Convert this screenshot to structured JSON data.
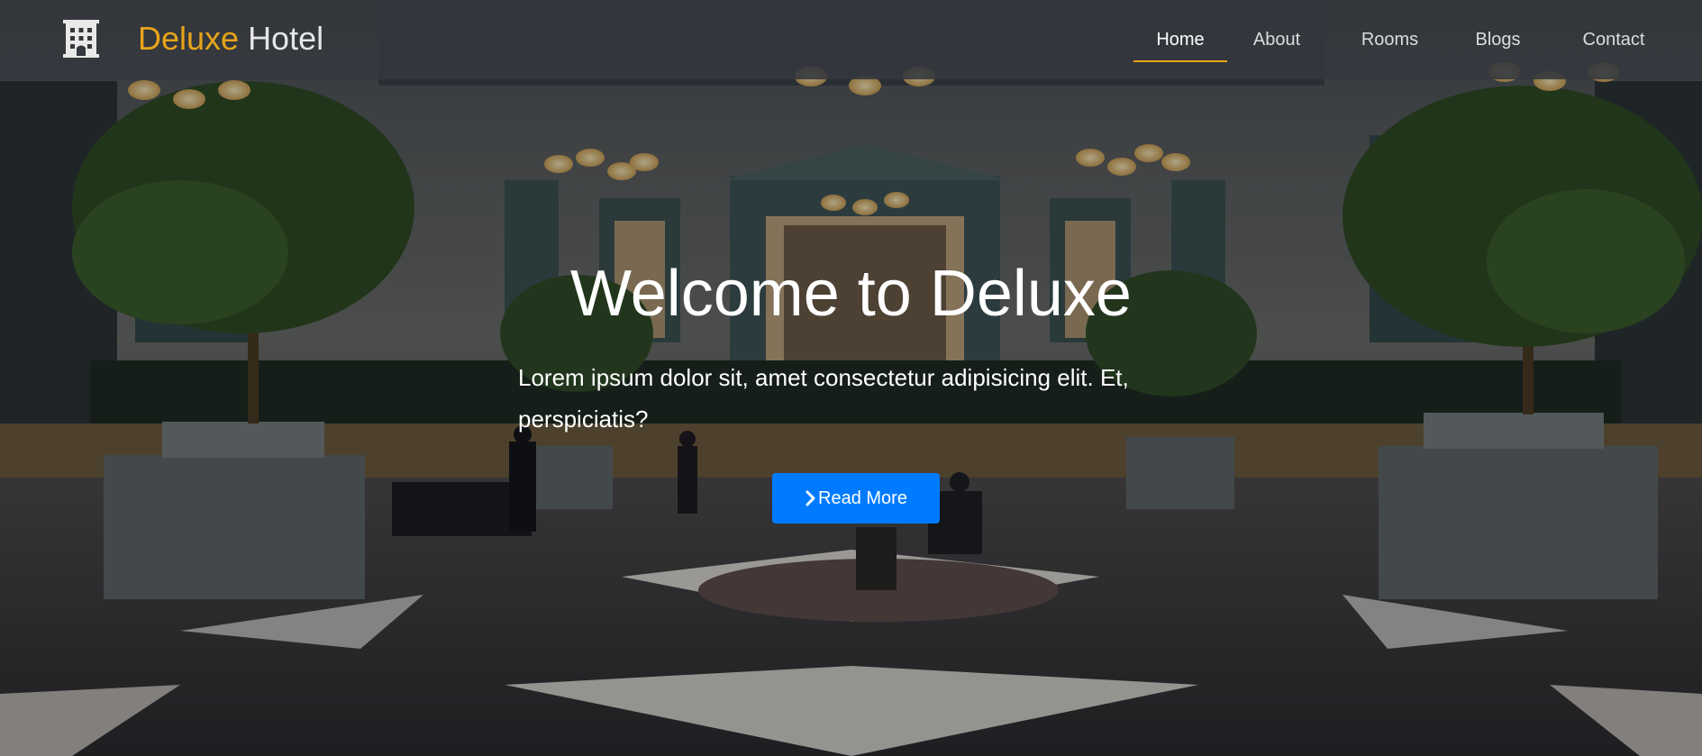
{
  "colors": {
    "brand_accent": "#e7a41a",
    "navbar_bg": "#34383e",
    "primary_button": "#007bff",
    "text_light": "#ffffff"
  },
  "navbar": {
    "logo_icon": "hotel-building-icon",
    "brand": {
      "part1": "Deluxe",
      "part2": "Hotel"
    },
    "links": [
      {
        "label": "Home",
        "active": true
      },
      {
        "label": "About",
        "active": false
      },
      {
        "label": "Rooms",
        "active": false
      },
      {
        "label": "Blogs",
        "active": false
      },
      {
        "label": "Contact",
        "active": false
      }
    ]
  },
  "hero": {
    "background": "hotel-lobby-photo",
    "title": "Welcome to Deluxe",
    "text": "Lorem ipsum dolor sit, amet consectetur adipisicing elit. Et, perspiciatis?",
    "button": {
      "label": "Read More",
      "icon": "chevron-right-icon"
    }
  }
}
